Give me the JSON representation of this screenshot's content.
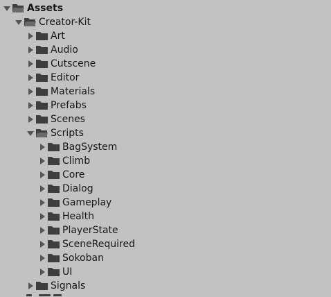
{
  "tree": {
    "root": {
      "label": "Assets",
      "expanded": true
    },
    "creator_kit": {
      "label": "Creator-Kit",
      "expanded": true
    },
    "top_folders": [
      {
        "label": "Art",
        "expanded": false
      },
      {
        "label": "Audio",
        "expanded": false
      },
      {
        "label": "Cutscene",
        "expanded": false
      },
      {
        "label": "Editor",
        "expanded": false
      },
      {
        "label": "Materials",
        "expanded": false
      },
      {
        "label": "Prefabs",
        "expanded": false
      },
      {
        "label": "Scenes",
        "expanded": false
      }
    ],
    "scripts": {
      "label": "Scripts",
      "expanded": true
    },
    "script_children": [
      {
        "label": "BagSystem",
        "expanded": false
      },
      {
        "label": "Climb",
        "expanded": false
      },
      {
        "label": "Core",
        "expanded": false
      },
      {
        "label": "Dialog",
        "expanded": false
      },
      {
        "label": "Gameplay",
        "expanded": false
      },
      {
        "label": "Health",
        "expanded": false
      },
      {
        "label": "PlayerState",
        "expanded": false
      },
      {
        "label": "SceneRequired",
        "expanded": false
      },
      {
        "label": "Sokoban",
        "expanded": false
      },
      {
        "label": "UI",
        "expanded": false
      }
    ],
    "signals": {
      "label": "Signals",
      "expanded": false
    }
  },
  "icons": {
    "folder": "folder-icon",
    "folder_open": "folder-open-icon",
    "arrow_right": "arrow-right-icon",
    "arrow_down": "arrow-down-icon"
  },
  "colors": {
    "background": "#c2c2c2",
    "text": "#161616",
    "folder": "#3e3e3e",
    "arrow": "#555555"
  }
}
